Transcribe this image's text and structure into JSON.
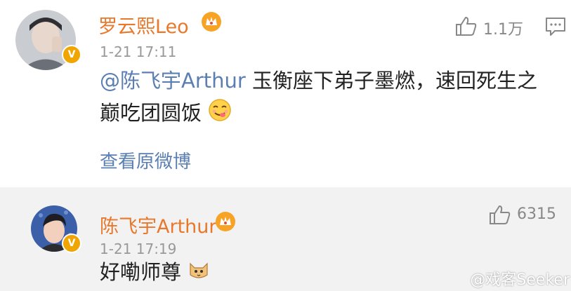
{
  "comments": [
    {
      "author": "罗云熙Leo",
      "time": "1-21 17:11",
      "likes": "1.1万",
      "text_mention": "@陈飞宇Arthur",
      "text_line1": " 玉衡座下弟子墨燃，速回死生之",
      "text_line2": "巅吃团圆饭",
      "view_original": "查看原微博",
      "verified_badge": "V"
    },
    {
      "author": "陈飞宇Arthur",
      "time": "1-21 17:19",
      "likes": "6315",
      "text": "好嘞师尊",
      "verified_badge": "V"
    }
  ],
  "watermark": "@戏客Seeker",
  "icons": [
    "crown-badge-icon",
    "thumbs-up-icon",
    "comment-icon",
    "yummy-face-emoji",
    "cat-emoji"
  ],
  "colors": {
    "author_name": "#e8782b",
    "mention_link": "#5b7fb3",
    "muted_text": "#999999",
    "verified_badge": "#f0a500",
    "reply_background": "#f2f2f2"
  }
}
